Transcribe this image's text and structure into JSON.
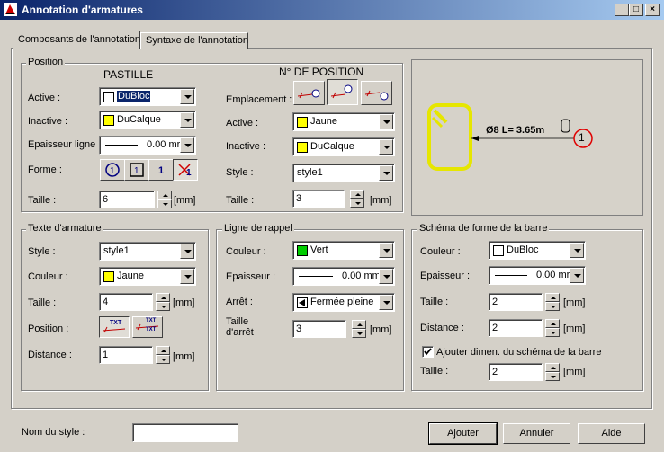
{
  "window": {
    "title": "Annotation d'armatures"
  },
  "tabs": [
    "Composants de l'annotation",
    "Syntaxe de l'annotation"
  ],
  "position": {
    "group_label": "Position",
    "pastille_header": "PASTILLE",
    "npos_header": "N° DE POSITION",
    "active_label": "Active :",
    "active_value": "DuBloc",
    "inactive_label": "Inactive :",
    "inactive_value": "DuCalque",
    "epaisseur_label": "Epaisseur ligne :",
    "epaisseur_value": "0.00 mr",
    "forme_label": "Forme :",
    "forme_icons": [
      "1",
      "1",
      "1",
      "1"
    ],
    "taille_label": "Taille :",
    "taille_value": "6",
    "unit": "[mm]",
    "emplacement_label": "Emplacement :",
    "n_active_label": "Active :",
    "n_active_value": "Jaune",
    "n_inactive_label": "Inactive :",
    "n_inactive_value": "DuCalque",
    "style_label": "Style :",
    "style_value": "style1",
    "n_taille_label": "Taille :",
    "n_taille_value": "3"
  },
  "preview": {
    "dimension_text": "Ø8 L= 3.65m",
    "circle_number": "1"
  },
  "texte": {
    "group_label": "Texte d'armature",
    "style_label": "Style :",
    "style_value": "style1",
    "couleur_label": "Couleur :",
    "couleur_value": "Jaune",
    "taille_label": "Taille :",
    "taille_value": "4",
    "position_label": "Position :",
    "pos_icon_text": "TXT",
    "distance_label": "Distance :",
    "distance_value": "1",
    "unit": "[mm]"
  },
  "rappel": {
    "group_label": "Ligne de rappel",
    "couleur_label": "Couleur :",
    "couleur_value": "Vert",
    "epaisseur_label": "Epaisseur :",
    "epaisseur_value": "0.00 mm",
    "arret_label": "Arrêt :",
    "arret_value": "Fermée pleine",
    "taille_label_1": "Taille",
    "taille_label_2": "d'arrêt",
    "taille_value": "3",
    "unit": "[mm]"
  },
  "schema": {
    "group_label": "Schéma de forme de la barre",
    "couleur_label": "Couleur :",
    "couleur_value": "DuBloc",
    "epaisseur_label": "Epaisseur :",
    "epaisseur_value": "0.00 mr",
    "taille_label": "Taille :",
    "taille_value": "2",
    "distance_label": "Distance :",
    "distance_value": "2",
    "checkbox_label": "Ajouter dimen. du schéma de la barre",
    "checkbox_checked": true,
    "taille2_label": "Taille :",
    "taille2_value": "2",
    "unit": "[mm]"
  },
  "footer": {
    "nom_label": "Nom du style :",
    "nom_value": "",
    "ajouter": "Ajouter",
    "annuler": "Annuler",
    "aide": "Aide"
  },
  "colors": {
    "yellow": "#ffff00",
    "green": "#00cc00",
    "white": "#ffffff",
    "titlebar": "#0a246a"
  }
}
